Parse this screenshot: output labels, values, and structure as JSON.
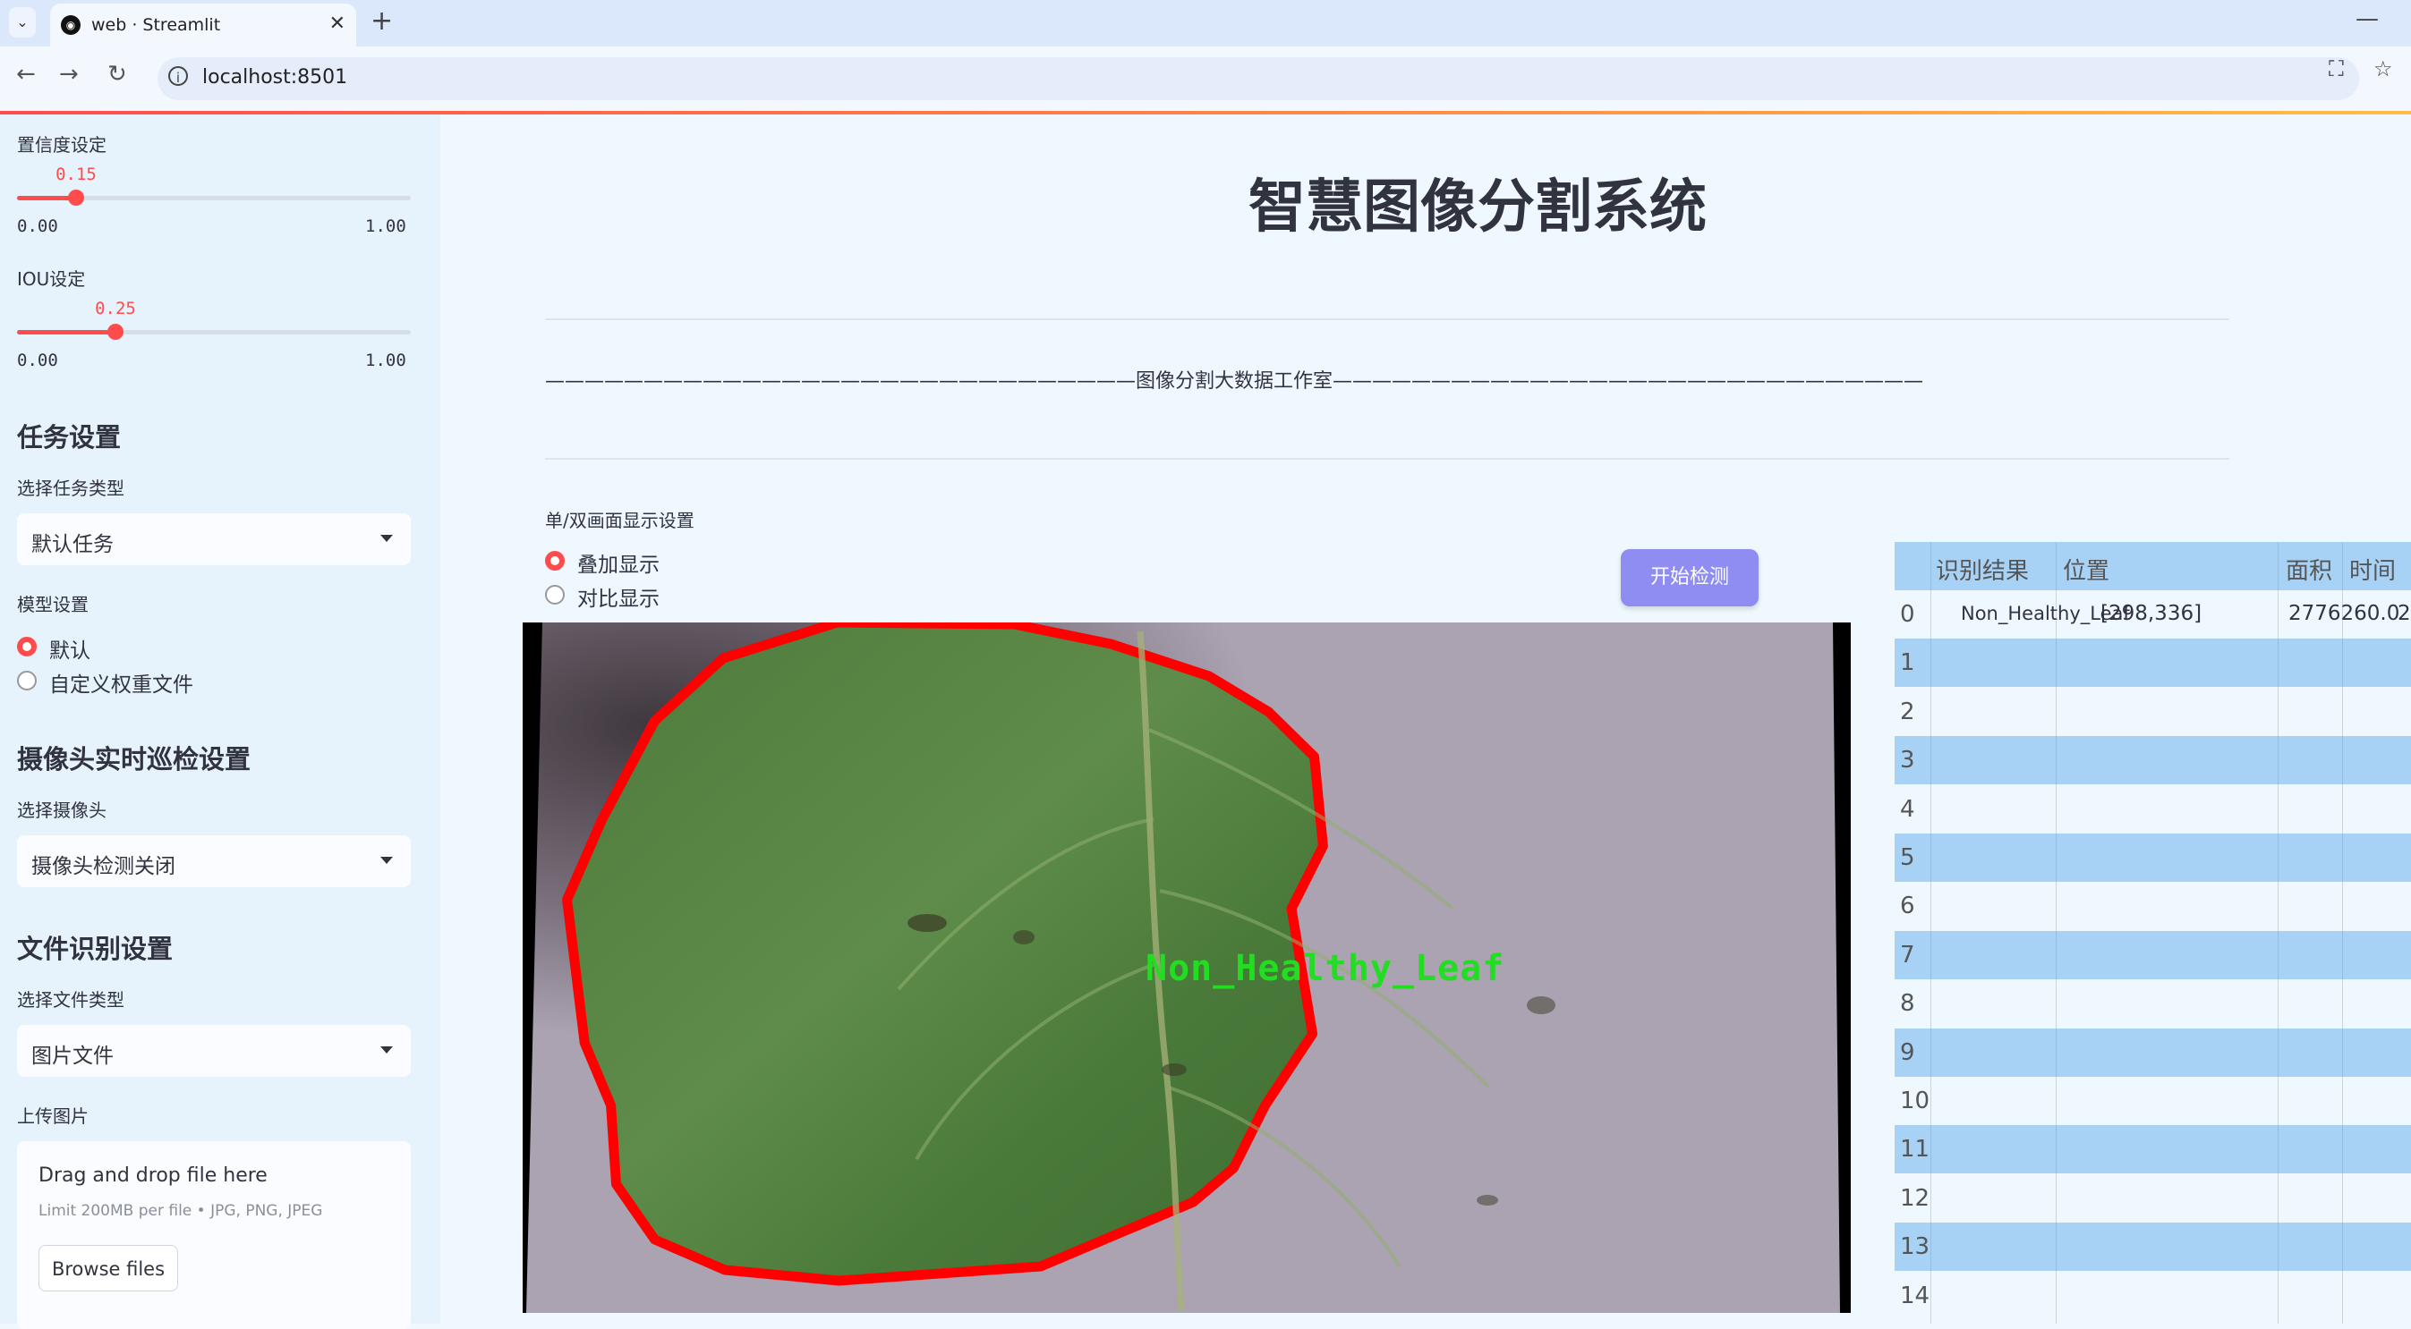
{
  "browser": {
    "tab_title": "web · Streamlit",
    "url": "localhost:8501"
  },
  "sidebar": {
    "confidence": {
      "label": "置信度设定",
      "value": "0.15",
      "fraction": 0.15,
      "min": "0.00",
      "max": "1.00"
    },
    "iou": {
      "label": "IOU设定",
      "value": "0.25",
      "fraction": 0.25,
      "min": "0.00",
      "max": "1.00"
    },
    "task_heading": "任务设置",
    "task_type_label": "选择任务类型",
    "task_type_value": "默认任务",
    "model_label": "模型设置",
    "model_options": [
      {
        "label": "默认",
        "selected": true
      },
      {
        "label": "自定义权重文件",
        "selected": false
      }
    ],
    "camera_heading": "摄像头实时巡检设置",
    "camera_label": "选择摄像头",
    "camera_value": "摄像头检测关闭",
    "file_heading": "文件识别设置",
    "file_type_label": "选择文件类型",
    "file_type_value": "图片文件",
    "upload_label": "上传图片",
    "upload_title": "Drag and drop file here",
    "upload_limit": "Limit 200MB per file • JPG, PNG, JPEG",
    "browse_label": "Browse files"
  },
  "main": {
    "title": "智慧图像分割系统",
    "dash_text": "——————————————————————————————图像分割大数据工作室——————————————————————————————",
    "display_label": "单/双画面显示设置",
    "display_options": [
      {
        "label": "叠加显示",
        "selected": true
      },
      {
        "label": "对比显示",
        "selected": false
      }
    ],
    "start_button": "开始检测",
    "detection_label": "Non_Healthy_Leaf"
  },
  "table": {
    "columns": [
      "识别结果",
      "位置",
      "面积",
      "时间"
    ],
    "rows": [
      {
        "index": "0",
        "result": "Non_Healthy_Leaf",
        "position": "[298,336]",
        "area": "2776260.0",
        "time": "2"
      },
      {
        "index": "1"
      },
      {
        "index": "2"
      },
      {
        "index": "3"
      },
      {
        "index": "4"
      },
      {
        "index": "5"
      },
      {
        "index": "6"
      },
      {
        "index": "7"
      },
      {
        "index": "8"
      },
      {
        "index": "9"
      },
      {
        "index": "10"
      },
      {
        "index": "11"
      },
      {
        "index": "12"
      },
      {
        "index": "13"
      },
      {
        "index": "14"
      }
    ]
  },
  "colors": {
    "accent": "#ff4b4b",
    "button": "#8f8df2",
    "table_stripe": "#a8d2f5",
    "sidebar_bg": "#e6f3fd",
    "outline": "#ff0000",
    "label_green": "#22dd22"
  }
}
